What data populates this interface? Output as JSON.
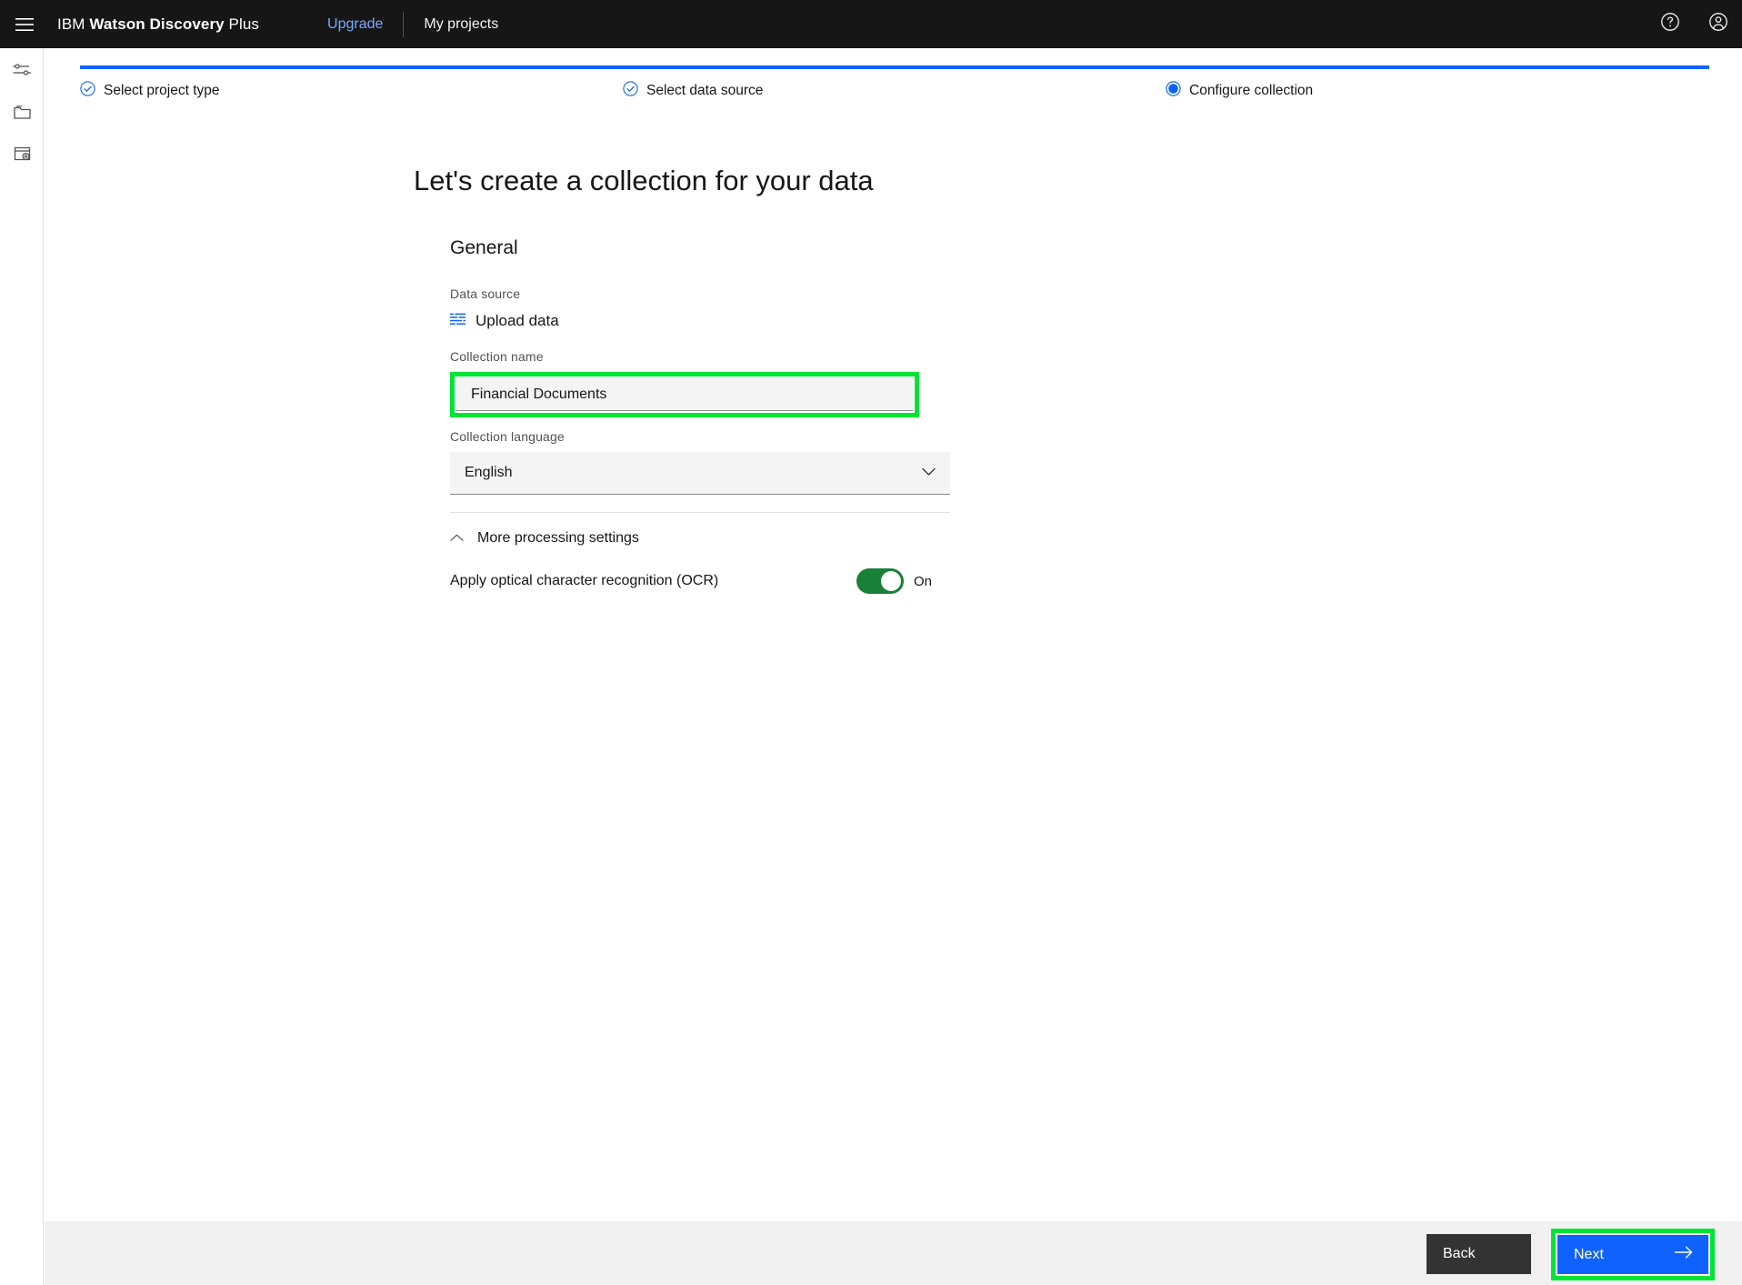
{
  "header": {
    "menu_icon": "hamburger-icon",
    "brand_prefix": "IBM ",
    "brand_bold": "Watson Discovery",
    "brand_suffix": " Plus",
    "upgrade_label": "Upgrade",
    "projects_label": "My projects",
    "help_icon": "help-icon",
    "account_icon": "user-avatar-icon",
    "colors": {
      "bar_bg": "#161616",
      "upgrade_link": "#78a9ff"
    }
  },
  "rail": {
    "items": [
      {
        "icon": "sliders-settings-icon",
        "name": "manage-collections"
      },
      {
        "icon": "folder-icon",
        "name": "projects"
      },
      {
        "icon": "document-settings-icon",
        "name": "integrate-deploy"
      }
    ]
  },
  "stepper": {
    "progress_color": "#0f62fe",
    "steps": [
      {
        "label": "Select project type",
        "state": "complete",
        "icon": "check-circle-icon"
      },
      {
        "label": "Select data source",
        "state": "complete",
        "icon": "check-circle-icon"
      },
      {
        "label": "Configure collection",
        "state": "current",
        "icon": "radio-filled-icon"
      }
    ]
  },
  "main": {
    "page_title": "Let's create a collection for your data",
    "section_title": "General",
    "data_source": {
      "label": "Data source",
      "icon": "upload-data-icon",
      "value": "Upload data"
    },
    "collection_name": {
      "label": "Collection name",
      "value": "Financial Documents",
      "placeholder": "Collection name",
      "highlight_color": "#00e533"
    },
    "collection_language": {
      "label": "Collection language",
      "value": "English",
      "chevron_icon": "chevron-down-icon"
    },
    "more_processing": {
      "label": "More processing settings",
      "chevron_icon": "chevron-up-icon",
      "expanded": true
    },
    "ocr": {
      "label": "Apply optical character recognition (OCR)",
      "state_text": "On",
      "on": true,
      "on_color": "#198038"
    }
  },
  "footer": {
    "back_label": "Back",
    "next_label": "Next",
    "next_icon": "arrow-right-icon",
    "next_highlight_color": "#00e533",
    "next_bg": "#0f62fe"
  }
}
